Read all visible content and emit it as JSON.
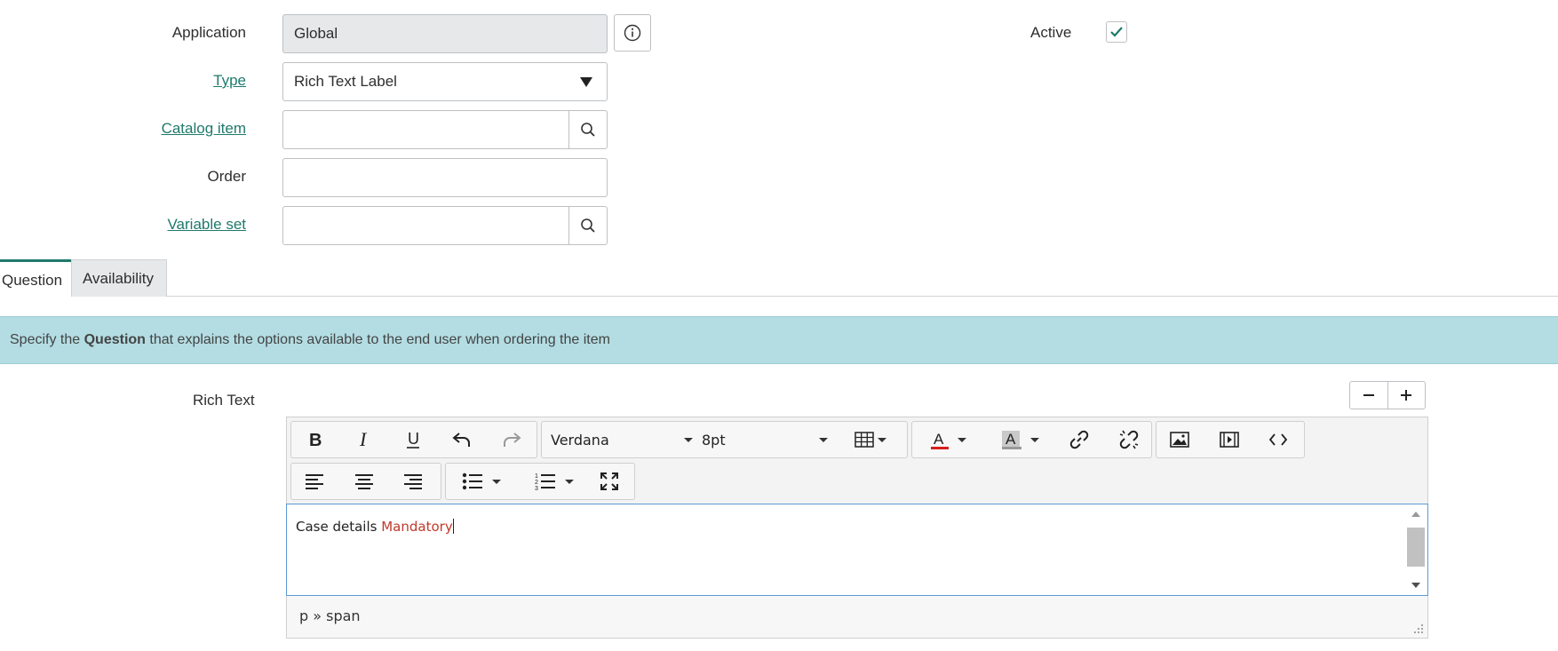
{
  "form": {
    "application": {
      "label": "Application",
      "value": "Global"
    },
    "type": {
      "label": "Type",
      "value": "Rich Text Label"
    },
    "catalog_item": {
      "label": "Catalog item",
      "value": ""
    },
    "order": {
      "label": "Order",
      "value": ""
    },
    "variable_set": {
      "label": "Variable set",
      "value": ""
    },
    "active": {
      "label": "Active",
      "checked": true
    }
  },
  "tabs": [
    {
      "label": "Question",
      "active": true
    },
    {
      "label": "Availability",
      "active": false
    }
  ],
  "banner": {
    "prefix": "Specify the",
    "bold": "Question",
    "suffix": "that explains the options available to the end user when ordering the item"
  },
  "rich_text": {
    "label": "Rich Text",
    "font_family": "Verdana",
    "font_size": "8pt",
    "content_plain": "Case details",
    "content_highlight": "Mandatory",
    "highlight_color": "#c0392b",
    "status_path": "p » span"
  },
  "colors": {
    "accent": "#1f7a6b",
    "banner_bg": "#b3dde3"
  }
}
